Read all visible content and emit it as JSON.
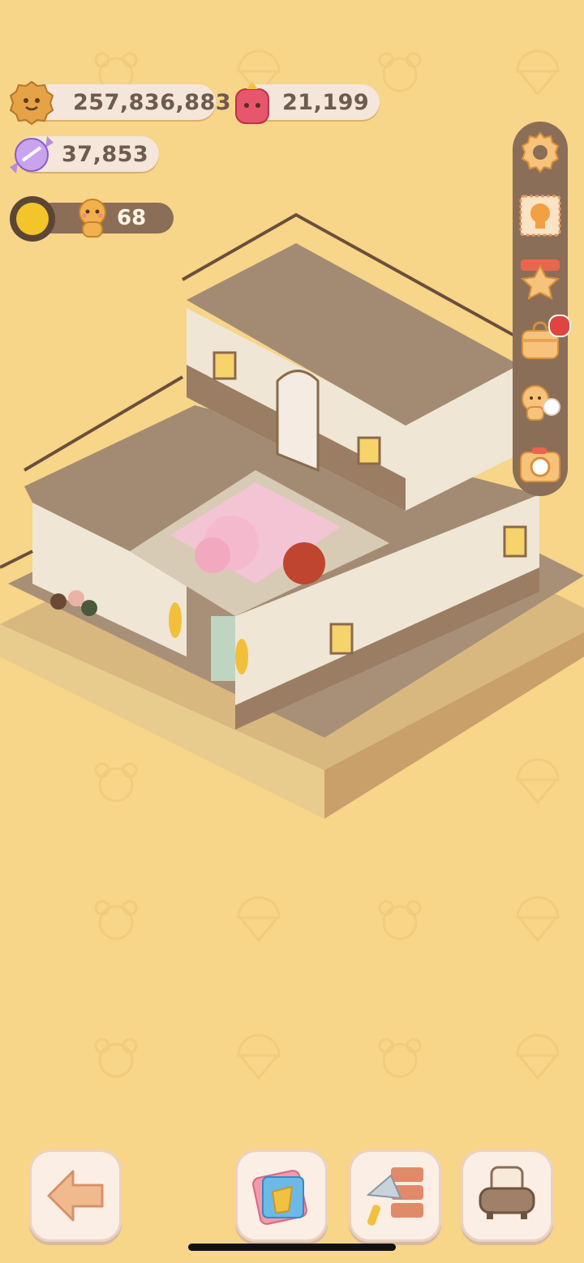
{
  "currencies": {
    "cookies": "257,836,883",
    "gems": "21,199",
    "candy": "37,853"
  },
  "level": {
    "count": "68"
  },
  "side_menu": [
    {
      "name": "settings",
      "icon": "gear-icon"
    },
    {
      "name": "stamp",
      "icon": "stamp-card-icon"
    },
    {
      "name": "favorites",
      "icon": "star-shop-icon"
    },
    {
      "name": "bag",
      "icon": "bag-icon",
      "badge": true
    },
    {
      "name": "friends",
      "icon": "friends-icon"
    },
    {
      "name": "camera",
      "icon": "camera-icon"
    }
  ],
  "bottom_bar": [
    {
      "name": "back",
      "icon": "arrow-left-icon"
    },
    {
      "name": "decorate",
      "icon": "gift-card-icon"
    },
    {
      "name": "build",
      "icon": "trowel-bricks-icon"
    },
    {
      "name": "furniture",
      "icon": "sofa-icon"
    }
  ],
  "colors": {
    "background": "#f7d589",
    "panel": "#8a6e58",
    "pill": "#f4e6da",
    "badge": "#e0443e"
  }
}
